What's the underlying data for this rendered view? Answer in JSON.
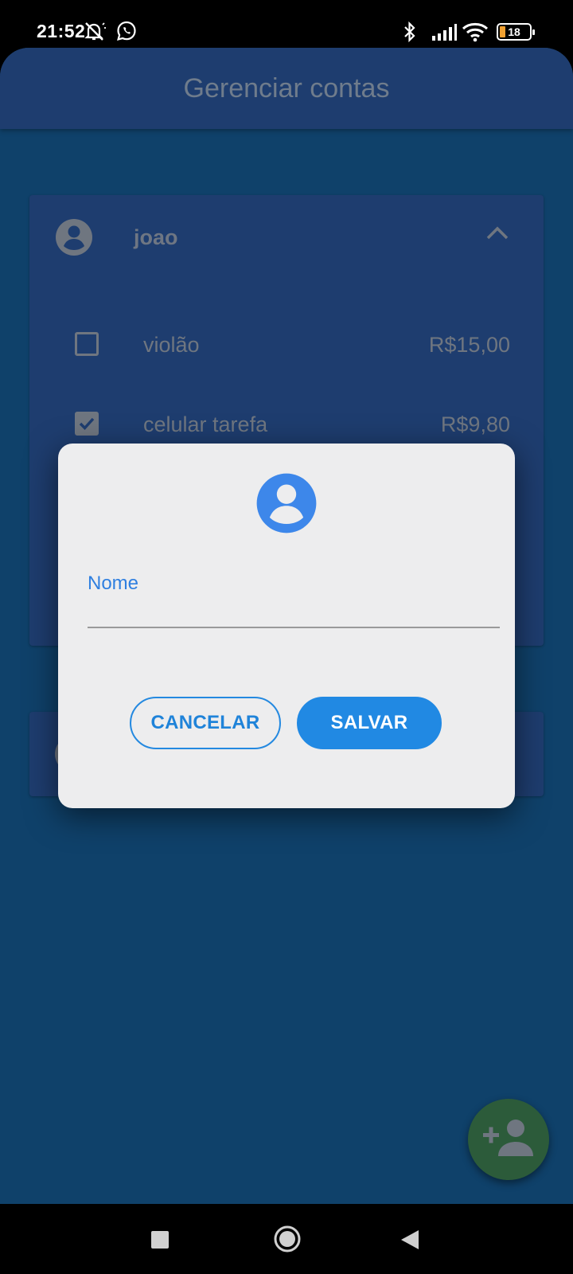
{
  "status_bar": {
    "time": "21:52",
    "battery": "18",
    "icons": [
      "mute-alarm-icon",
      "whatsapp-icon",
      "bluetooth-icon",
      "signal-icon",
      "wifi-icon",
      "battery-icon"
    ]
  },
  "app_bar": {
    "title": "Gerenciar contas"
  },
  "account": {
    "name": "joao",
    "expanded": true,
    "bills": [
      {
        "name": "violão",
        "value": "R$15,00",
        "checked": false
      },
      {
        "name": "celular tarefa",
        "value": "R$9,80",
        "checked": true
      }
    ]
  },
  "dialog": {
    "field_label": "Nome",
    "field_value": "",
    "cancel_label": "CANCELAR",
    "save_label": "SALVAR"
  },
  "fab": {
    "icon": "add-person-icon"
  },
  "nav_bar": {
    "icons": [
      "recents-square-icon",
      "home-circle-icon",
      "back-triangle-icon"
    ]
  },
  "colors": {
    "primary": "#2189e3",
    "app_background": "#0f416a",
    "app_bar": "#1e3d6f",
    "dialog_background": "#ededee",
    "fab": "#2c5b3a"
  }
}
